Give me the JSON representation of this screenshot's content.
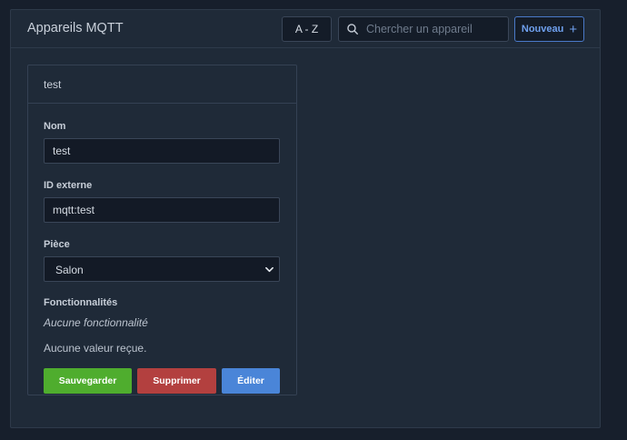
{
  "header": {
    "title": "Appareils MQTT",
    "sort_label": "A - Z",
    "search_placeholder": "Chercher un appareil",
    "search_value": "",
    "new_label": "Nouveau",
    "new_icon": "plus-icon"
  },
  "device": {
    "card_title": "test",
    "name_label": "Nom",
    "name_value": "test",
    "external_id_label": "ID externe",
    "external_id_value": "mqtt:test",
    "room_label": "Pièce",
    "room_value": "Salon",
    "features_label": "Fonctionnalités",
    "no_features_text": "Aucune fonctionnalité",
    "no_value_text": "Aucune valeur reçue."
  },
  "actions": {
    "save_label": "Sauvegarder",
    "delete_label": "Supprimer",
    "edit_label": "Éditer"
  },
  "colors": {
    "background": "#171f2c",
    "panel": "#1f2a38",
    "accent": "#4a79c8",
    "save": "#4fad2e",
    "delete": "#b3403f",
    "edit": "#4a85d8"
  }
}
